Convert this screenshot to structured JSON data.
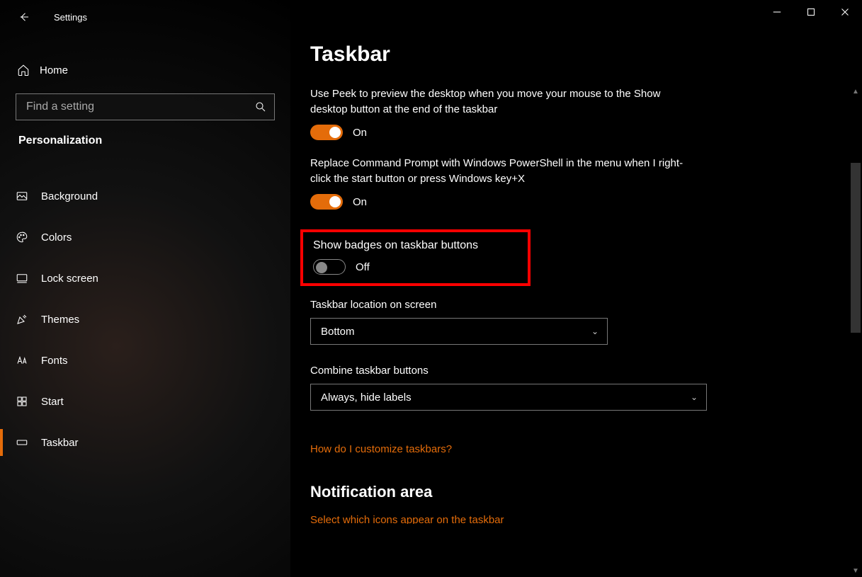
{
  "header": {
    "app_title": "Settings"
  },
  "sidebar": {
    "home_label": "Home",
    "search_placeholder": "Find a setting",
    "category": "Personalization",
    "items": [
      {
        "label": "Background"
      },
      {
        "label": "Colors"
      },
      {
        "label": "Lock screen"
      },
      {
        "label": "Themes"
      },
      {
        "label": "Fonts"
      },
      {
        "label": "Start"
      },
      {
        "label": "Taskbar"
      }
    ]
  },
  "page": {
    "title": "Taskbar",
    "settings": {
      "peek": {
        "desc": "Use Peek to preview the desktop when you move your mouse to the Show desktop button at the end of the taskbar",
        "state": "On"
      },
      "powershell": {
        "desc": "Replace Command Prompt with Windows PowerShell in the menu when I right-click the start button or press Windows key+X",
        "state": "On"
      },
      "badges": {
        "desc": "Show badges on taskbar buttons",
        "state": "Off"
      },
      "location": {
        "label": "Taskbar location on screen",
        "value": "Bottom"
      },
      "combine": {
        "label": "Combine taskbar buttons",
        "value": "Always, hide labels"
      }
    },
    "link_customize": "How do I customize taskbars?",
    "section_notification": "Notification area",
    "link_icons": "Select which icons appear on the taskbar"
  }
}
